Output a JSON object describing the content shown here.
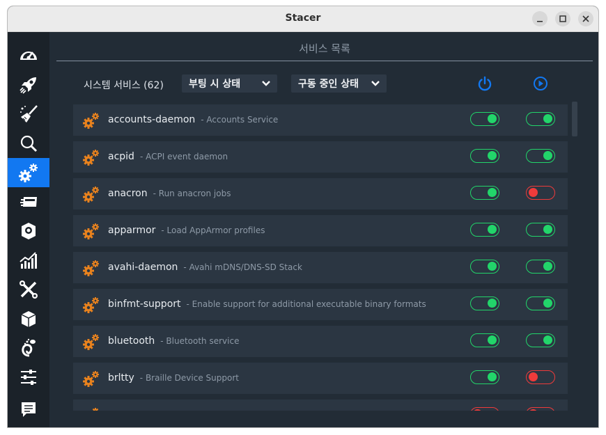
{
  "window": {
    "title": "Stacer"
  },
  "sidebar": {
    "items": [
      {
        "icon": "dashboard-icon",
        "active": false
      },
      {
        "icon": "rocket-icon",
        "active": false
      },
      {
        "icon": "broom-icon",
        "active": false
      },
      {
        "icon": "search-icon",
        "active": false
      },
      {
        "icon": "gears-icon",
        "active": true
      },
      {
        "icon": "processes-icon",
        "active": false
      },
      {
        "icon": "uninstaller-icon",
        "active": false
      },
      {
        "icon": "resources-icon",
        "active": false
      },
      {
        "icon": "tools-icon",
        "active": false
      },
      {
        "icon": "package-icon",
        "active": false
      },
      {
        "icon": "gnome-icon",
        "active": false
      },
      {
        "icon": "settings-sliders-icon",
        "active": false
      },
      {
        "icon": "feedback-icon",
        "active": false
      }
    ]
  },
  "header": {
    "title": "서비스 목록"
  },
  "toolbar": {
    "service_count_label": "시스템 서비스 (62)",
    "boot_filter": "부팅 시 상태",
    "running_filter": "구동 중인 상태"
  },
  "colors": {
    "accent": "#1278f1",
    "on": "#22d56a",
    "off": "#f03b3b",
    "gear": "#e8821e"
  },
  "services": [
    {
      "name": "accounts-daemon",
      "desc": "- Accounts Service",
      "boot": true,
      "running": true
    },
    {
      "name": "acpid",
      "desc": "- ACPI event daemon",
      "boot": true,
      "running": true
    },
    {
      "name": "anacron",
      "desc": "- Run anacron jobs",
      "boot": true,
      "running": false
    },
    {
      "name": "apparmor",
      "desc": "- Load AppArmor profiles",
      "boot": true,
      "running": true
    },
    {
      "name": "avahi-daemon",
      "desc": "- Avahi mDNS/DNS-SD Stack",
      "boot": true,
      "running": true
    },
    {
      "name": "binfmt-support",
      "desc": "- Enable support for additional executable binary formats",
      "boot": true,
      "running": true
    },
    {
      "name": "bluetooth",
      "desc": "- Bluetooth service",
      "boot": true,
      "running": true
    },
    {
      "name": "brltty",
      "desc": "- Braille Device Support",
      "boot": true,
      "running": false
    },
    {
      "name": "",
      "desc": "",
      "boot": false,
      "running": false
    }
  ]
}
